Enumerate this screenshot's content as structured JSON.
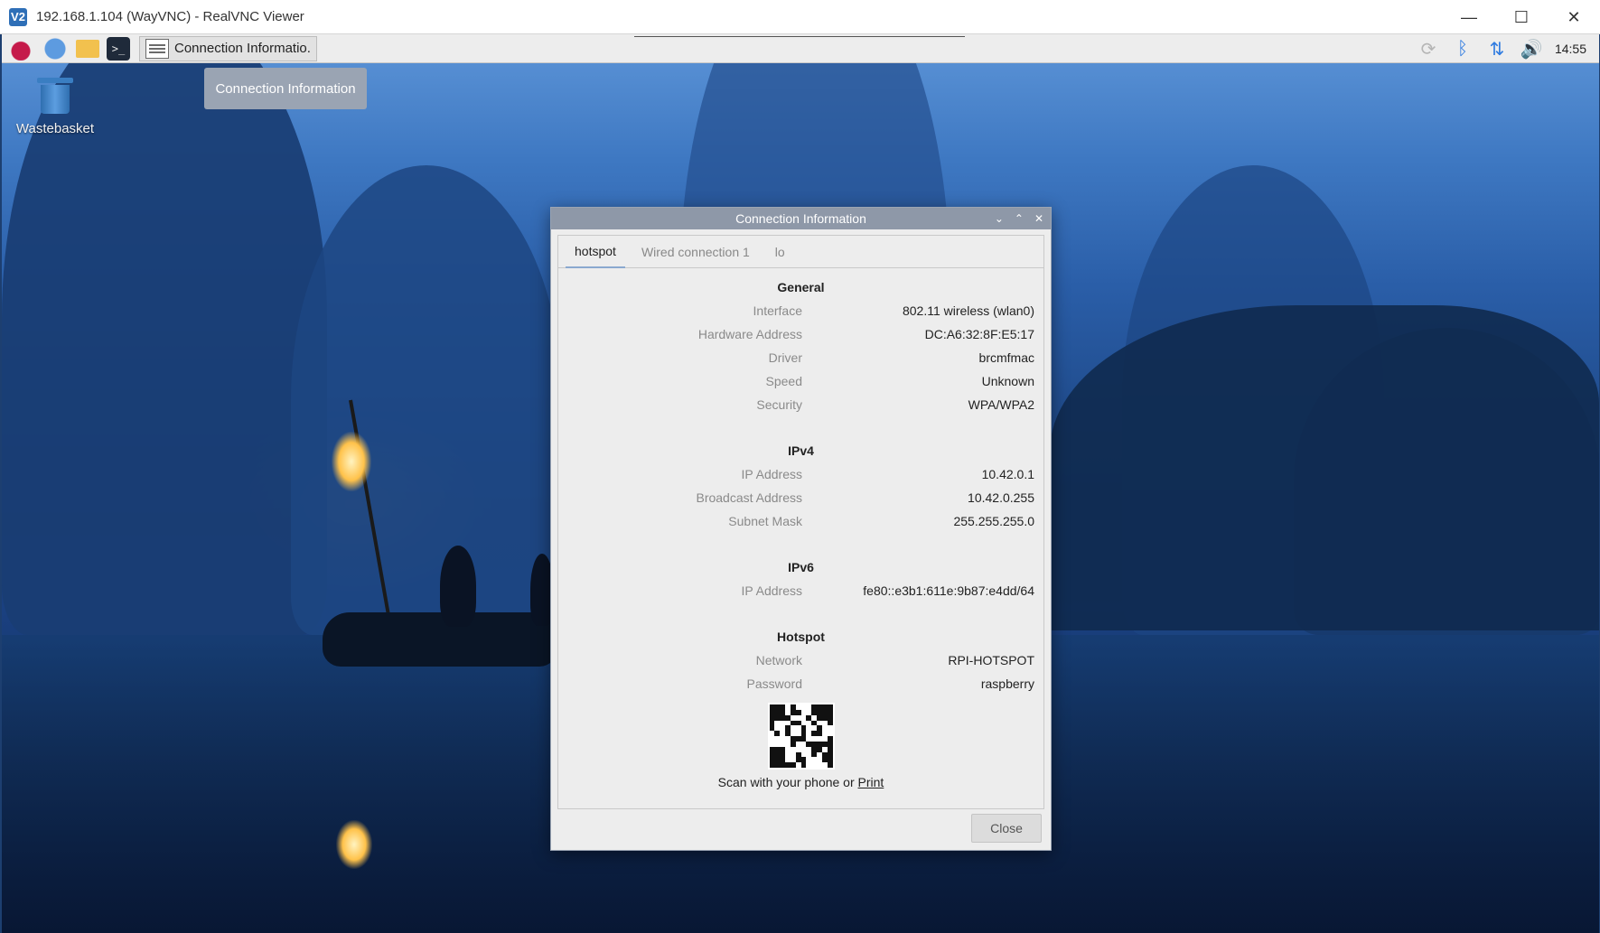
{
  "vnc": {
    "title": "192.168.1.104 (WayVNC) - RealVNC Viewer",
    "logo_glyph": "V2",
    "minimize": "—",
    "maximize": "☐",
    "close": "✕"
  },
  "panel": {
    "terminal_glyph": ">_",
    "task_label": "Connection Informatio.",
    "clock": "14:55",
    "tray_icons": [
      "sync-icon",
      "bluetooth-icon",
      "network-arrows-icon",
      "volume-icon"
    ]
  },
  "tooltip": {
    "text": "Connection Information"
  },
  "desktop": {
    "trash_label": "Wastebasket"
  },
  "dialog": {
    "title": "Connection Information",
    "tabs": [
      "hotspot",
      "Wired connection 1",
      "lo"
    ],
    "active_tab": 0,
    "sections": {
      "general": {
        "title": "General",
        "rows": [
          {
            "k": "Interface",
            "v": "802.11 wireless (wlan0)"
          },
          {
            "k": "Hardware Address",
            "v": "DC:A6:32:8F:E5:17"
          },
          {
            "k": "Driver",
            "v": "brcmfmac"
          },
          {
            "k": "Speed",
            "v": "Unknown"
          },
          {
            "k": "Security",
            "v": "WPA/WPA2"
          }
        ]
      },
      "ipv4": {
        "title": "IPv4",
        "rows": [
          {
            "k": "IP Address",
            "v": "10.42.0.1"
          },
          {
            "k": "Broadcast Address",
            "v": "10.42.0.255"
          },
          {
            "k": "Subnet Mask",
            "v": "255.255.255.0"
          }
        ]
      },
      "ipv6": {
        "title": "IPv6",
        "rows": [
          {
            "k": "IP Address",
            "v": "fe80::e3b1:611e:9b87:e4dd/64"
          }
        ]
      },
      "hotspot": {
        "title": "Hotspot",
        "rows": [
          {
            "k": "Network",
            "v": "RPI-HOTSPOT"
          },
          {
            "k": "Password",
            "v": "raspberry"
          }
        ]
      }
    },
    "scan_text": "Scan with your phone or ",
    "print_link": "Print",
    "close_label": "Close"
  }
}
